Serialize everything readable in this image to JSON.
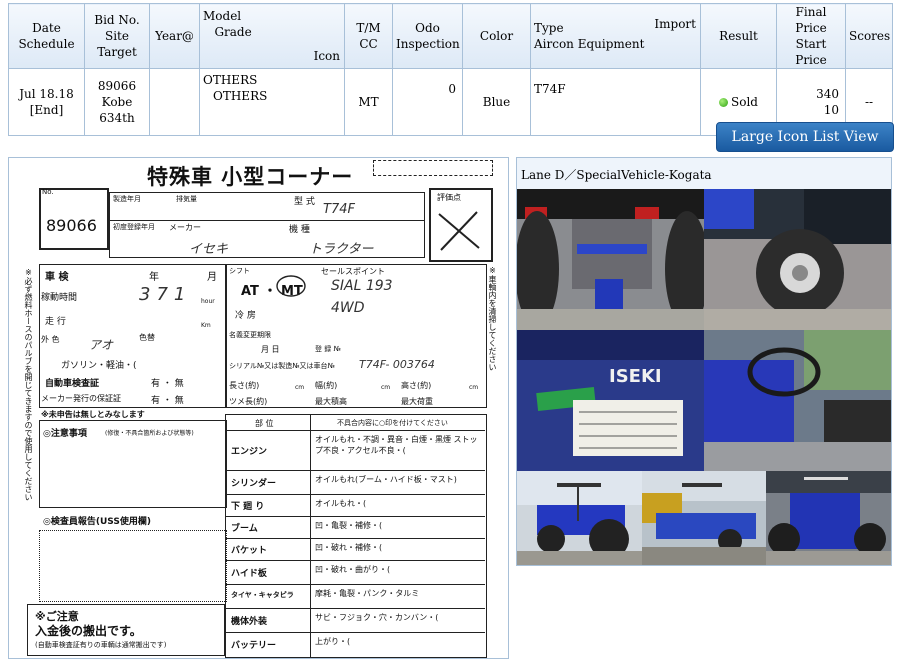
{
  "summary": {
    "headers": {
      "date_l1": "Date",
      "date_l2": "Schedule",
      "bid_l1": "Bid No.",
      "bid_l2": "Site",
      "bid_l3": "Target",
      "year": "Year@",
      "model_l1": "Model",
      "model_l2": "Grade",
      "model_icon": "Icon",
      "tm_l1": "T/M",
      "tm_l2": "CC",
      "odo_l1": "Odo",
      "odo_l2": "Inspection",
      "color": "Color",
      "type_l1": "Type",
      "type_import": "Import",
      "type_l2": "Aircon Equipment",
      "result": "Result",
      "price_l1": "Final Price",
      "price_l2": "Start Price",
      "scores": "Scores"
    },
    "row": {
      "date": "Jul 18.18",
      "date_status": "[End]",
      "bid_no": "89066",
      "site": "Kobe",
      "target": "634th",
      "year": "",
      "model": "OTHERS",
      "grade": "OTHERS",
      "tm": "MT",
      "cc": "",
      "odo": "0",
      "inspection": "",
      "color": "Blue",
      "type": "T74F",
      "result": "Sold",
      "final_price": "340",
      "start_price": "10",
      "scores": "--"
    }
  },
  "list_view_button": "Large Icon List View",
  "sheet": {
    "title": "特殊車  小型コーナー",
    "eval_label": "評価点",
    "no_label": "No.",
    "lot_no": "89066",
    "maker_name": "製造年月",
    "displacement": "排気量",
    "model_type_label": "型 式",
    "model_type": "T74F",
    "first_reg_label": "初度登録年月",
    "maker_label": "メーカー",
    "maker": "イセキ",
    "machine_label": "機 種",
    "machine": "トラクター",
    "vehicle_check": "車 検",
    "year_label": "年",
    "month_label": "月",
    "hours_label": "稼動時間",
    "hours_value": "371",
    "hour_unit": "hour",
    "run_label": "走 行",
    "km_unit": "Km",
    "ext_label": "外 色",
    "color_label": "色替",
    "color_value": "アオ",
    "fuel_label": "ガソリン・軽油・(",
    "inspection_cert": "自動車検査証",
    "maker_warranty": "メーカー発行の保証証",
    "yes_no": "有 ・ 無",
    "shift_label": "シフト",
    "shift_value": "AT ・ MT",
    "cool_label": "冷 房",
    "sales_label": "セールスポイント",
    "sales_value1": "SIAL 193",
    "sales_value2": "4WD",
    "name_change_label": "名義変更期限",
    "day_label": "月  日",
    "reg_label": "登 録 №",
    "serial_label": "シリアル№又は製造№又は車台№",
    "serial_value": "T74F- 003764",
    "length_label": "長さ(約)",
    "width_label": "幅(約)",
    "height_label": "高さ(約)",
    "cm": "cm",
    "claw_label": "ツメ長(約)",
    "max_cap": "最大積高",
    "max_weight": "最大荷重",
    "no_report": "※未申告は無しとみなします",
    "notes_label": "◎注意事項",
    "notes_sub": "(修復・不具合箇所および状態等)",
    "inspector_label": "◎検査員報告(USS使用欄)",
    "parts_header": "部 位",
    "defect_header": "不具合内容に○印を付けてください",
    "parts": [
      {
        "name": "エンジン",
        "detail": "オイルもれ・不調・異音・白煙・黒煙 ストップ不良・アクセル不良・("
      },
      {
        "name": "シリンダー",
        "detail": "オイルもれ(ブーム・ハイド板・マスト)"
      },
      {
        "name": "下 廻 り",
        "detail": "オイルもれ・("
      },
      {
        "name": "ブーム",
        "detail": "凹・亀裂・補修・("
      },
      {
        "name": "バケット",
        "detail": "凹・破れ・補修・("
      },
      {
        "name": "ハイド板",
        "detail": "凹・破れ・曲がり・("
      },
      {
        "name": "タイヤ・キャタピラ",
        "detail": "摩耗・亀裂・パンク・タルミ"
      },
      {
        "name": "機体外装",
        "detail": "サビ・フジョク・穴・カンバン・("
      },
      {
        "name": "バッテリー",
        "detail": "上がり・("
      }
    ],
    "side_note_left": "※必ず燃料ホースのパルブを開じてきますので使用してください",
    "side_note_right": "※車輌内を清掃してください",
    "caution_title": "※ご注意",
    "caution_line1": "入金後の搬出です。",
    "caution_line2": "(自動車検査証有りの車輌は通常搬出です)"
  },
  "photos": {
    "lane_title": "Lane D／SpecialVehicle-Kogata"
  },
  "colors": {
    "header_bg": "#dde9f6",
    "border": "#a8c0d8",
    "button_bg": "#1f62a8",
    "sold_dot": "#2ea212",
    "tractor_blue": "#2030b0"
  }
}
